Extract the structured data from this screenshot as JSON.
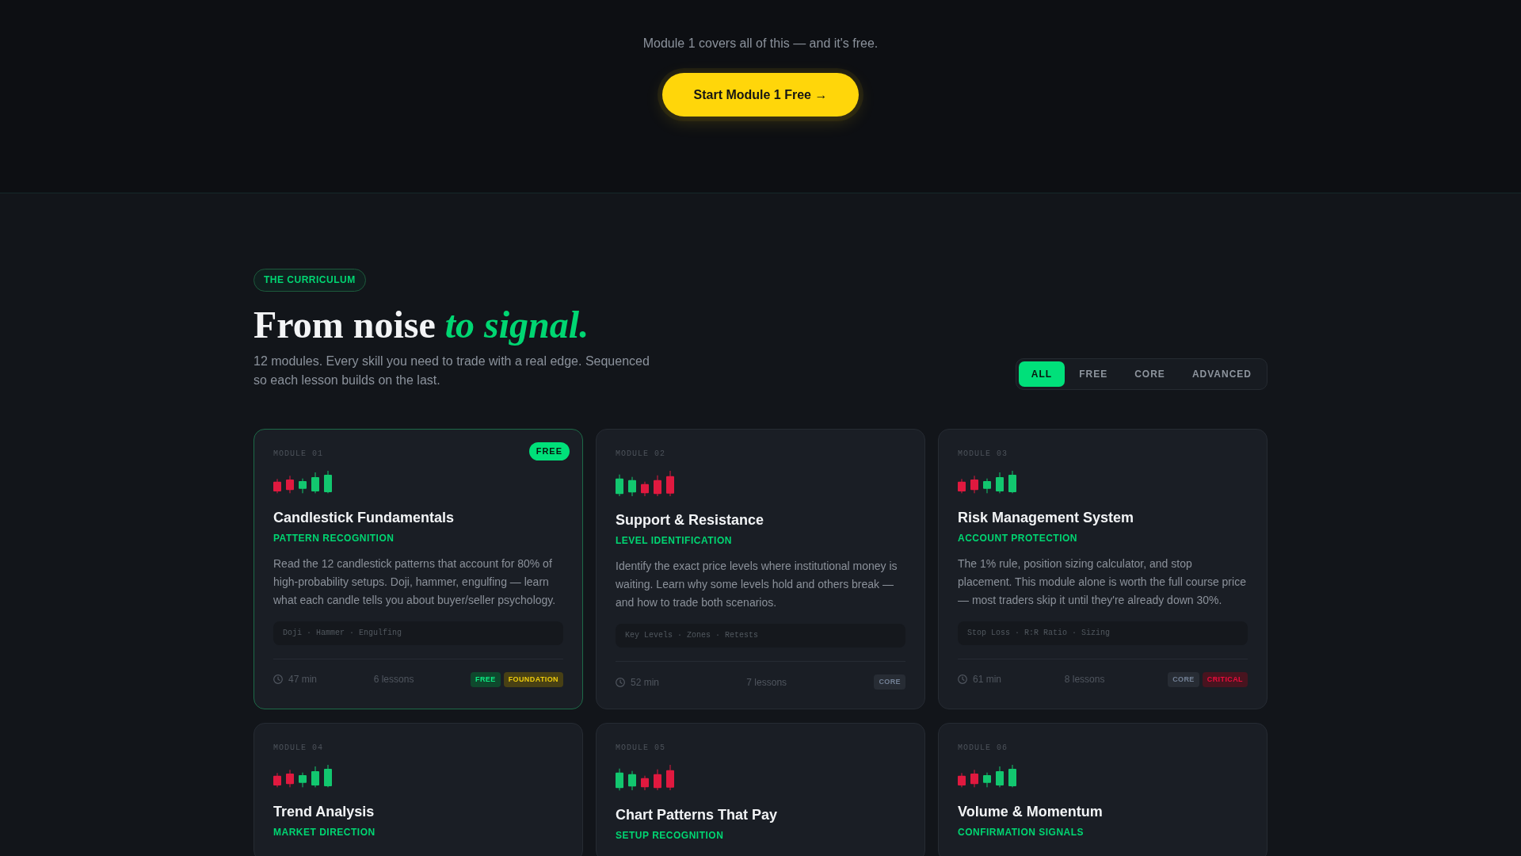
{
  "cta": {
    "note": "Module 1 covers all of this — and it's free.",
    "button": "Start Module 1 Free →"
  },
  "curriculum": {
    "eyebrow": "THE CURRICULUM",
    "heading": "From noise *to signal.*",
    "description": "12 modules. Every skill you need to trade with a real edge. Sequenced so each lesson builds on the last.",
    "filters": [
      {
        "label": "ALL",
        "selected": true
      },
      {
        "label": "FREE",
        "selected": false
      },
      {
        "label": "CORE",
        "selected": false
      },
      {
        "label": "ADVANCED",
        "selected": false
      }
    ],
    "modules": [
      {
        "number": "MODULE 01",
        "badge": "FREE",
        "highlighted": true,
        "kind": "rising",
        "title": "Candlestick Fundamentals",
        "subtitle": "PATTERN RECOGNITION",
        "description": "Read the 12 candlestick patterns that account for 80% of high-probability setups. Doji, hammer, engulfing — learn what each candle tells you about buyer/seller psychology.",
        "topics": "Doji · Hammer · Engulfing",
        "duration": "47 min",
        "lessons": "6 lessons",
        "tags": [
          {
            "label": "FREE",
            "color": "#0f482d"
          },
          {
            "label": "FOUNDATION",
            "color": "#484014"
          }
        ]
      },
      {
        "number": "MODULE 02",
        "highlighted": false,
        "kind": "falling",
        "title": "Support & Resistance",
        "subtitle": "LEVEL IDENTIFICATION",
        "description": "Identify the exact price levels where institutional money is waiting. Learn why some levels hold and others break — and how to trade both scenarios.",
        "topics": "Key Levels · Zones · Retests",
        "duration": "52 min",
        "lessons": "7 lessons",
        "tags": [
          {
            "label": "CORE",
            "color": "#272c34"
          }
        ]
      },
      {
        "number": "MODULE 03",
        "highlighted": false,
        "kind": "rising",
        "title": "Risk Management System",
        "subtitle": "ACCOUNT PROTECTION",
        "description": "The 1% rule, position sizing calculator, and stop placement. This module alone is worth the full course price — most traders skip it until they're already down 30%.",
        "topics": "Stop Loss · R:R Ratio · Sizing",
        "duration": "61 min",
        "lessons": "8 lessons",
        "tags": [
          {
            "label": "CORE",
            "color": "#272c34"
          },
          {
            "label": "CRITICAL",
            "color": "#48141f"
          }
        ]
      },
      {
        "number": "MODULE 04",
        "highlighted": false,
        "kind": "rising",
        "title": "Trend Analysis",
        "subtitle": "MARKET DIRECTION"
      },
      {
        "number": "MODULE 05",
        "highlighted": false,
        "kind": "falling",
        "title": "Chart Patterns That Pay",
        "subtitle": "SETUP RECOGNITION"
      },
      {
        "number": "MODULE 06",
        "highlighted": false,
        "kind": "rising",
        "title": "Volume & Momentum",
        "subtitle": "CONFIRMATION SIGNALS"
      }
    ]
  }
}
